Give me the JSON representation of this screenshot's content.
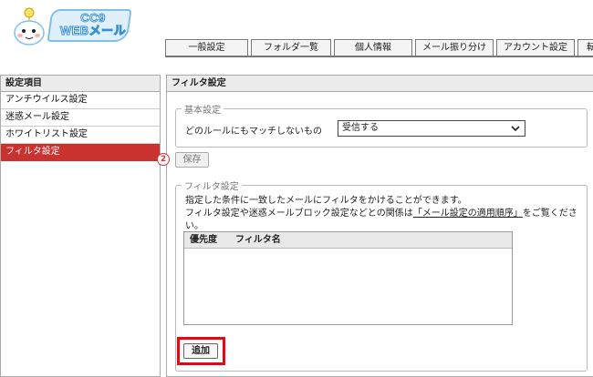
{
  "logo": {
    "line1": "CC9",
    "line2": "WEBメール"
  },
  "tabs": [
    {
      "label": "一般設定"
    },
    {
      "label": "フォルダ一覧"
    },
    {
      "label": "個人情報"
    },
    {
      "label": "メール振り分け"
    },
    {
      "label": "アカウント設定"
    },
    {
      "label": "転"
    }
  ],
  "sidebar": {
    "heading": "設定項目",
    "items": [
      {
        "label": "アンチウイルス設定"
      },
      {
        "label": "迷惑メール設定"
      },
      {
        "label": "ホワイトリスト設定"
      },
      {
        "label": "フィルタ設定",
        "active": true
      }
    ]
  },
  "panel": {
    "heading": "フィルタ設定",
    "basic": {
      "legend": "基本設定",
      "rule_label": "どのルールにもマッチしないもの",
      "rule_value": "受信する"
    },
    "save_label": "保存",
    "step_marker": "2",
    "filter": {
      "legend": "フィルタ設定",
      "desc_line1": "指定した条件に一致したメールにフィルタをかけることができます。",
      "desc_line2_pre": "フィルタ設定や迷惑メールブロック設定などとの関係は",
      "desc_link": "「メール設定の適用順序」",
      "desc_line2_post": "をご覧ください。",
      "columns": [
        "優先度",
        "フィルタ名"
      ],
      "rows": [],
      "add_label": "追加"
    }
  },
  "colors": {
    "active": "#c9322e",
    "highlight": "#e20a0a",
    "logo_blue": "#3a8fd0"
  }
}
